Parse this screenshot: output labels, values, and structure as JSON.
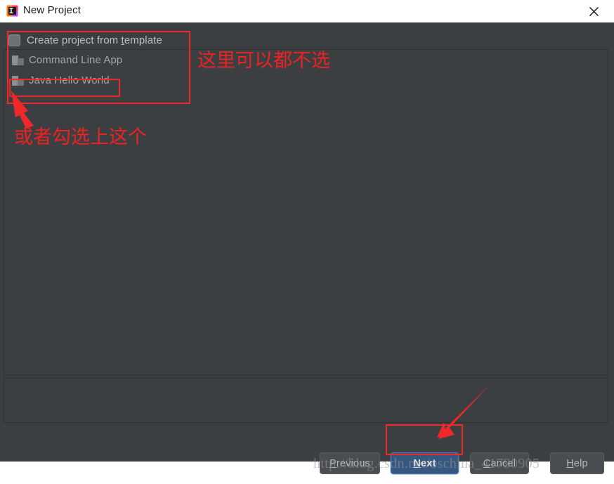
{
  "window": {
    "title": "New Project",
    "app_icon": "intellij-idea-icon",
    "close_icon": "close-icon"
  },
  "tree_panel": {
    "checkbox": {
      "label_before": "Create project from ",
      "label_accel": "t",
      "label_after": "emplate",
      "checked": false,
      "icon": "checkbox-unchecked-icon"
    },
    "items": [
      {
        "label": "Command Line App",
        "icon": "folder-icon",
        "selected": false
      },
      {
        "label": "Java Hello World",
        "icon": "folder-icon",
        "selected": false
      }
    ]
  },
  "buttons": {
    "previous": {
      "label_before": "P",
      "label_after": "revious",
      "accel": "P",
      "default": false
    },
    "next": {
      "label_before": "N",
      "label_after": "ext",
      "accel": "N",
      "default": true
    },
    "cancel": {
      "label_before": "C",
      "label_after": "ancel",
      "accel": "C",
      "default": false
    },
    "help": {
      "label_before": "H",
      "label_after": "elp",
      "accel": "H",
      "default": false
    }
  },
  "watermark": {
    "text": "http://blog.csdn.net/oschina_41790905"
  },
  "annotations": {
    "color": "#ee2222",
    "text_top": "这里可以都不选",
    "text_bottom": "或者勾选上这个",
    "boxes": [
      {
        "name": "template-section-box"
      },
      {
        "name": "java-hello-world-box"
      },
      {
        "name": "next-button-box"
      }
    ]
  },
  "colors": {
    "dialog_background": "#3c3f41",
    "titlebar_background": "#ffffff",
    "panel_border": "#2e3133",
    "default_button": "#365880",
    "annotation_red": "#ee2222",
    "text_primary": "#bfbfbf",
    "text_secondary": "#a6a6a6"
  }
}
